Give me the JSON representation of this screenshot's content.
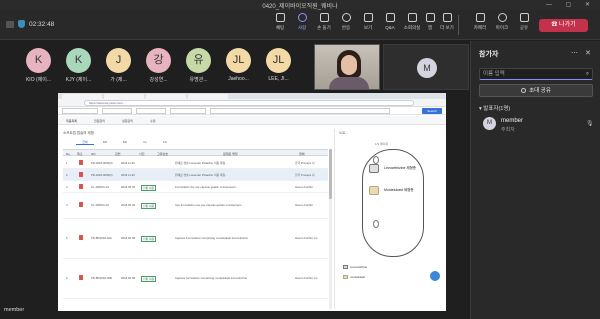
{
  "window": {
    "title": "0420_제이바이오직원_웨비나",
    "controls": "— ▢ ✕"
  },
  "meeting": {
    "elapsed": "02:32:48",
    "toolbar": [
      {
        "label": "채팅"
      },
      {
        "label": "사람"
      },
      {
        "label": "손 들기"
      },
      {
        "label": "반응"
      },
      {
        "label": "보기"
      },
      {
        "label": "Q&A"
      },
      {
        "label": "소회의실"
      },
      {
        "label": "앱"
      },
      {
        "label": "더 보기"
      },
      {
        "label": "카메라"
      },
      {
        "label": "마이크"
      },
      {
        "label": "공유"
      }
    ],
    "leave_label": "나가기"
  },
  "gallery": {
    "tiles": [
      {
        "initial": "K",
        "name": "KIO (제이...",
        "color": "#e7b3c0"
      },
      {
        "initial": "K",
        "name": "KJY (제이...",
        "color": "#a8d8b9"
      },
      {
        "initial": "J",
        "name": "가 (제...",
        "color": "#f2d9a6"
      },
      {
        "initial": "강",
        "name": "강성연...",
        "color": "#e7b3c0"
      },
      {
        "initial": "유",
        "name": "유명관...",
        "color": "#c8d9a8"
      },
      {
        "initial": "JL",
        "name": "Jaehoo...",
        "color": "#f2d9a6"
      },
      {
        "initial": "JL",
        "name": "LEE, JI...",
        "color": "#f2d9a6"
      }
    ],
    "member_tile_initial": "M"
  },
  "shared_screen": {
    "presenter": "member",
    "url": "https://www.keynote.com/...",
    "right_button": "Search",
    "nav": [
      "제품목록",
      "전원관리",
      "실험관리",
      "수정"
    ],
    "subtitle": "소프트캡 캡슐의 제형",
    "filter_tabs": [
      "전체",
      "BR",
      "BD",
      "CL",
      "FG"
    ],
    "columns": [
      "No",
      "제출",
      "NO",
      "관련",
      "사진",
      "고유번호",
      "원재료 명칭",
      "업체"
    ],
    "rows": [
      {
        "no": "1",
        "code": "PR-2018-0096(0)",
        "date": "2018.11.30",
        "desc": "원재료 캡슐 Lavender Pistachio 적용 제형...",
        "vendor": "한국 Procaps 사",
        "badge": ""
      },
      {
        "no": "2",
        "code": "PR-2018-0096(2)",
        "date": "2018.11.30",
        "desc": "원재료 캡슐 Lavender Pistachio 적용 제형...",
        "vendor": "한국 Procaps 사",
        "badge": ""
      },
      {
        "no": "3",
        "code": "CL-180501-01",
        "date": "2018.05.02",
        "desc": "Formulation dip use capsule gelatin omnisenteric...",
        "vendor": "Hetero Fortifor",
        "badge": "현황 내용"
      },
      {
        "no": "4",
        "code": "CL-180501-02",
        "date": "2018.05.02",
        "desc": "Use formulation one use capsule gelatin omnisenteric...",
        "vendor": "Hetero Fortifor",
        "badge": "현황 내용"
      },
      {
        "no": "5",
        "code": "PR-BD2018-02A",
        "date": "2018.06.08",
        "desc": "Capsule Formulation comprising montelukast levocetirizine",
        "vendor": "Hetero Fortifor Co.",
        "badge": "현황 내용"
      },
      {
        "no": "6",
        "code": "PR-BD2018-02B",
        "date": "2018.06.08",
        "desc": "Capsule formulation comprising montelukast levocetirizine",
        "vendor": "Hetero Fortifor Co.",
        "badge": "현황 내용"
      }
    ],
    "panel": {
      "header": "노트",
      "page": "1/9 페이지",
      "label1": "Levocetirizine 제형층",
      "label2": "Montelukast 제형층",
      "legend": [
        "Levocetirizine",
        "montelukast"
      ]
    }
  },
  "side_panel": {
    "title": "참가자",
    "search_placeholder": "이름 입력",
    "invite_label": "초대 공유",
    "section_label": "발표자(1명)",
    "participant": {
      "initial": "M",
      "name": "member",
      "role": "주최자"
    }
  }
}
